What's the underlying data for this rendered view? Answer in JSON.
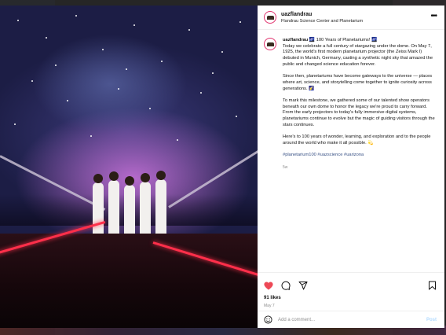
{
  "post": {
    "username": "uazflandrau",
    "location": "Flandrau Science Center and Planetarium",
    "caption": {
      "headline": "🌌 100 Years of Planetariums! 🌌",
      "p1": "Today we celebrate a full century of stargazing under the dome. On May 7, 1925, the world's first modern planetarium projector (the Zeiss Mark I) debuted in Munich, Germany, casting a synthetic night sky that amazed the public and changed science education forever.",
      "p2": "Since then, planetariums have become gateways to the universe — places where art, science, and storytelling come together to ignite curiosity across generations. 🌠",
      "p3": "To mark this milestone, we gathered some of our talented show operators beneath our own dome to honor the legacy we're proud to carry forward. From the early projectors to today's fully immersive digital systems, planetariums continue to evolve but the magic of guiding visitors through the stars continues.",
      "p4": "Here's to 100 years of wonder, learning, and exploration and to the people around the world who make it all possible. 💫",
      "tags": "#planetarium100 #uazscience #uarizona",
      "time": "5w"
    },
    "likes": "91 likes",
    "date": "May 7",
    "comment_placeholder": "Add a comment...",
    "post_button": "Post",
    "colors": {
      "like": "#ed4956",
      "tag": "#385185",
      "post_disabled": "#b3dbff"
    },
    "icons": [
      "more-icon",
      "heart-icon",
      "comment-icon",
      "share-icon",
      "bookmark-icon",
      "emoji-icon"
    ]
  }
}
